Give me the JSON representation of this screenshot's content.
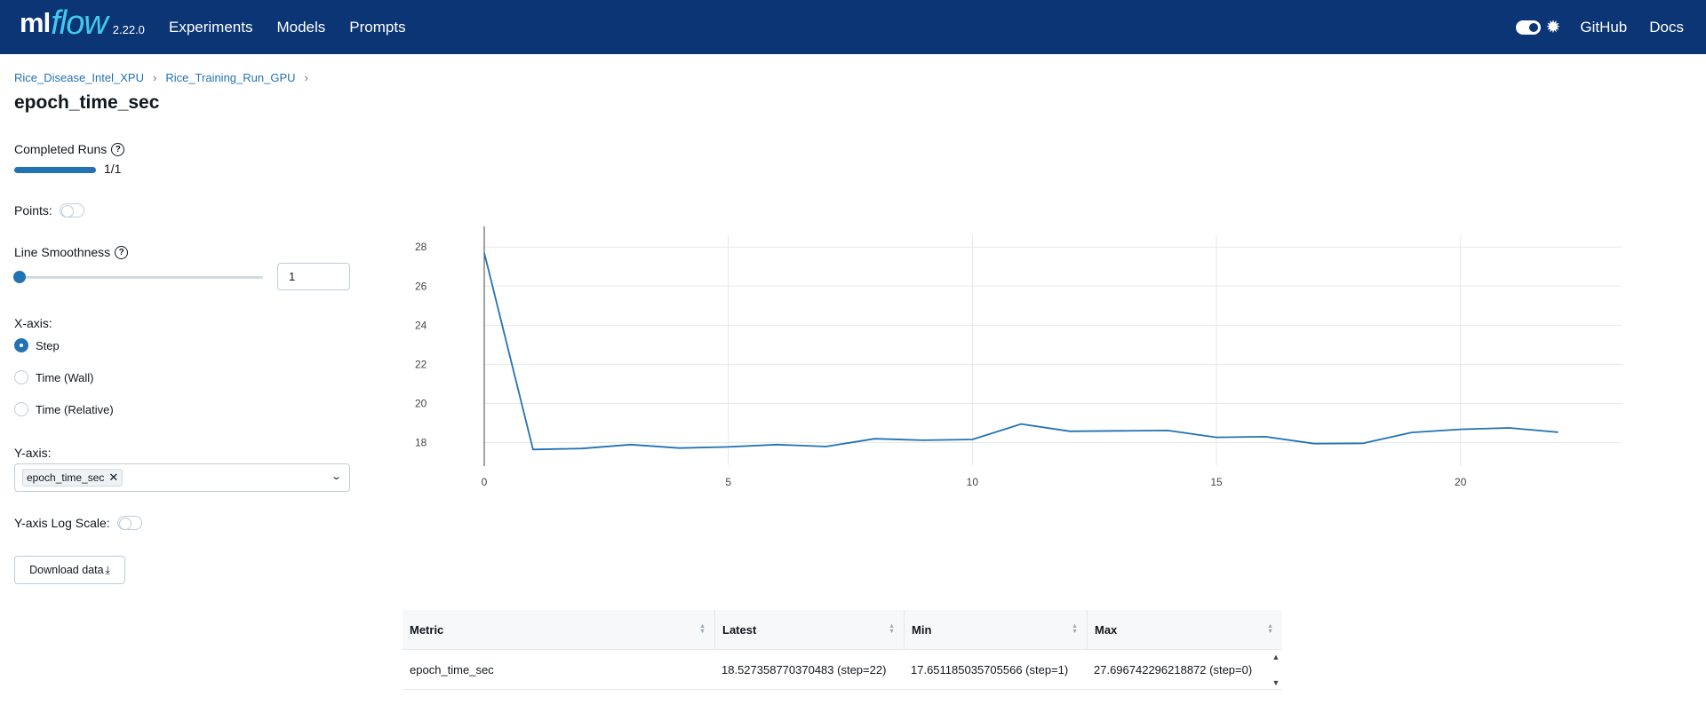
{
  "header": {
    "logo_ml": "ml",
    "logo_flow": "flow",
    "version": "2.22.0",
    "nav": [
      "Experiments",
      "Models",
      "Prompts"
    ],
    "right_links": [
      "GitHub",
      "Docs"
    ],
    "brand_color": "#0b3574"
  },
  "breadcrumb": [
    "Rice_Disease_Intel_XPU",
    "Rice_Training_Run_GPU"
  ],
  "page_title": "epoch_time_sec",
  "controls": {
    "completed_runs_label": "Completed Runs",
    "completed_runs_value": "1/1",
    "completed_runs_fraction": 1.0,
    "points_label": "Points:",
    "points_enabled": false,
    "smoothness_label": "Line Smoothness",
    "smoothness_value": "1",
    "xaxis_label": "X-axis:",
    "xaxis_options": [
      "Step",
      "Time (Wall)",
      "Time (Relative)"
    ],
    "xaxis_selected": "Step",
    "yaxis_label": "Y-axis:",
    "yaxis_selected": "epoch_time_sec",
    "ylog_label": "Y-axis Log Scale:",
    "ylog_enabled": false,
    "download_label": "Download data"
  },
  "chart_data": {
    "type": "line",
    "x": [
      0,
      1,
      2,
      3,
      4,
      5,
      6,
      7,
      8,
      9,
      10,
      11,
      12,
      13,
      14,
      15,
      16,
      17,
      18,
      19,
      20,
      21,
      22
    ],
    "series": [
      {
        "values": [
          27.7,
          17.65,
          17.7,
          17.9,
          17.72,
          17.78,
          17.9,
          17.8,
          18.2,
          18.12,
          18.16,
          18.95,
          18.58,
          18.6,
          18.62,
          18.27,
          18.3,
          17.95,
          17.96,
          18.52,
          18.68,
          18.75,
          18.53
        ],
        "color": "#2272b4"
      }
    ],
    "xlim": [
      0,
      23.3
    ],
    "ylim": [
      16.8,
      28.6
    ],
    "xticks": [
      0,
      5,
      10,
      15,
      20
    ],
    "yticks": [
      18,
      20,
      22,
      24,
      26,
      28
    ],
    "grid": true
  },
  "table": {
    "columns": [
      "Metric",
      "Latest",
      "Min",
      "Max"
    ],
    "rows": [
      [
        "epoch_time_sec",
        "18.527358770370483 (step=22)",
        "17.651185035705566 (step=1)",
        "27.696742296218872 (step=0)"
      ]
    ]
  }
}
